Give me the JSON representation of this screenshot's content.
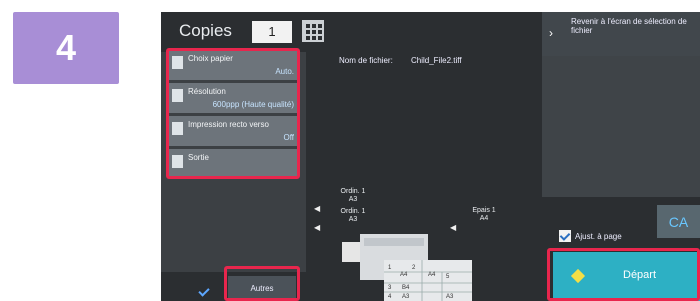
{
  "step_number": "4",
  "header": {
    "copies_label": "Copies",
    "copies_value": "1",
    "keypad_icon": "keypad-icon"
  },
  "options": [
    {
      "title": "Choix papier",
      "value": "Auto."
    },
    {
      "title": "Résolution",
      "value": "600ppp (Haute qualité)"
    },
    {
      "title": "Impression recto verso",
      "value": "Off"
    },
    {
      "title": "Sortie",
      "value": ""
    }
  ],
  "file": {
    "label": "Nom de fichier:",
    "name": "Child_File2.tiff"
  },
  "back_button": {
    "label": "Revenir à l'écran de sélection de fichier"
  },
  "trays": {
    "upper_left": {
      "line1": "Ordin. 1",
      "line2": "A3"
    },
    "mid_left": {
      "line1": "Ordin. 1",
      "line2": "A3"
    },
    "right": {
      "line1": "Epais 1",
      "line2": "A4"
    },
    "cassettes": [
      "1",
      "A4",
      "2",
      "A4",
      "5",
      "3",
      "B4",
      "4",
      "A3",
      "A3"
    ]
  },
  "fit_to_page": {
    "label": "Ajust. à page",
    "checked": true
  },
  "ca_button": "CA",
  "start_button": "Départ",
  "autres_button": "Autres",
  "colors": {
    "accent_red": "#e8264d",
    "start_blue": "#2db0c4",
    "badge_purple": "#a88ed6"
  }
}
